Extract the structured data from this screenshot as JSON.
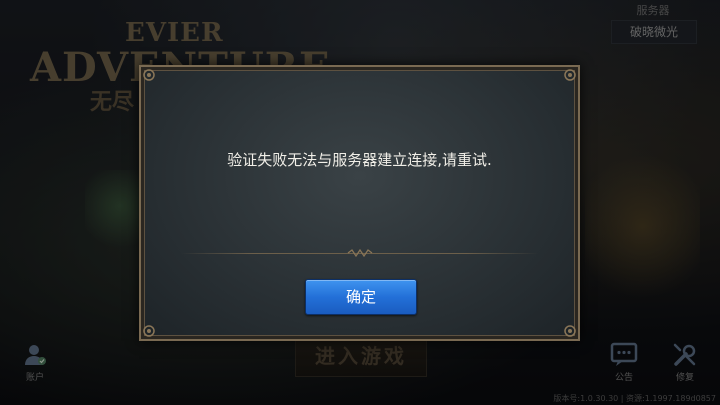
{
  "logo": {
    "line1": "EVIER",
    "line2": "ADVENTURE",
    "line3": "无尽"
  },
  "server": {
    "label": "服务器",
    "value": "破晓微光"
  },
  "dialog": {
    "message": "验证失败无法与服务器建立连接,请重试.",
    "confirm_label": "确定"
  },
  "enter_game_label": "进入游戏",
  "bottom_bar": {
    "account_label": "账户",
    "notice_label": "公告",
    "repair_label": "修复",
    "version_text": "版本号:1.0.30.30 | 资源:1.1997.189d0857"
  },
  "colors": {
    "button_blue": "#2370d8",
    "dialog_border": "#7a6a52",
    "logo_gold": "#6e6048"
  }
}
